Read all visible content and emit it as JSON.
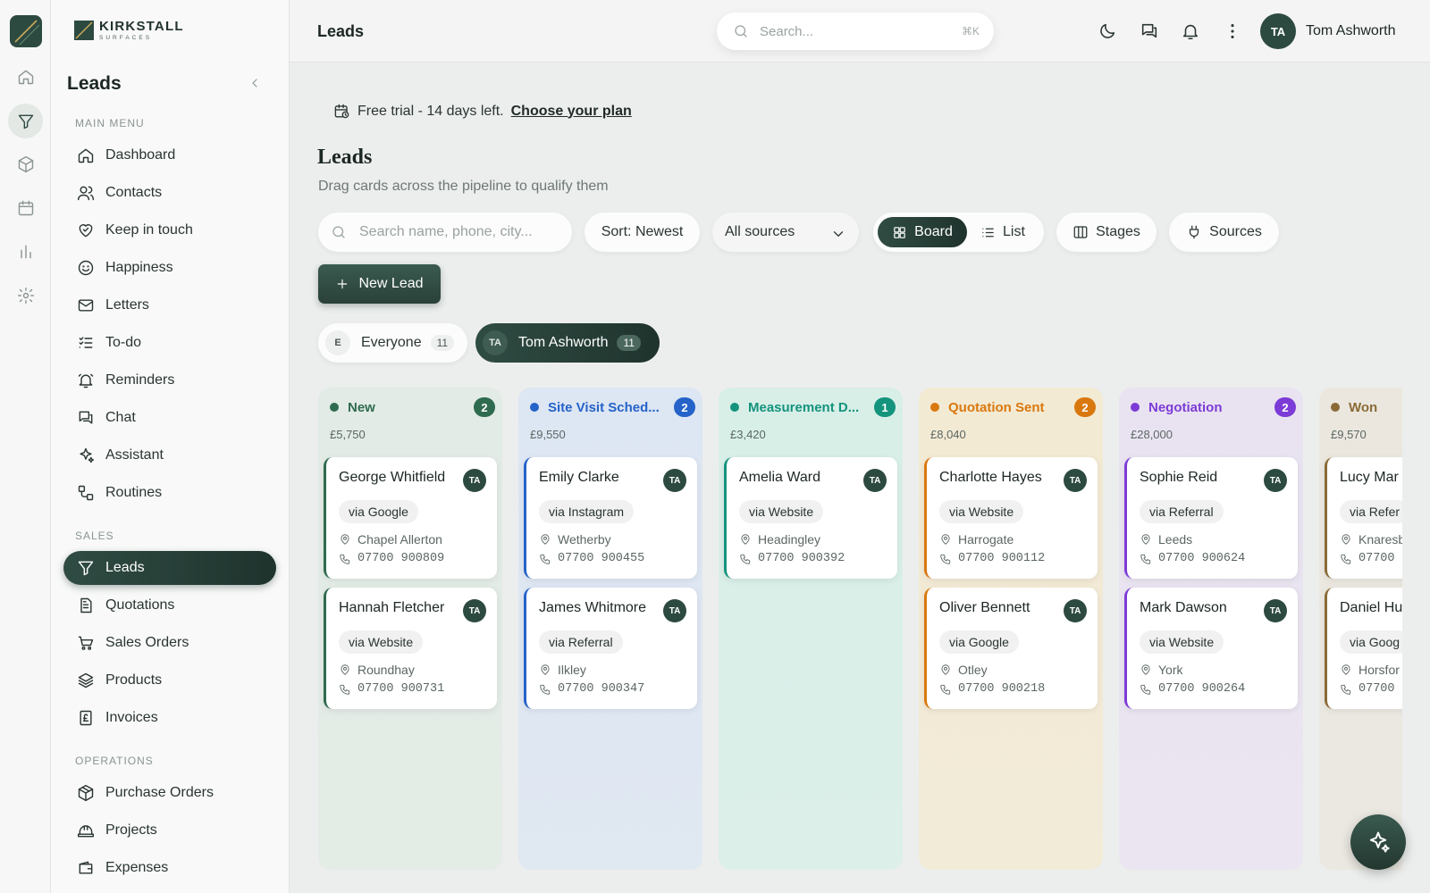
{
  "brand": {
    "name": "KIRKSTALL",
    "tagline": "SURFACES"
  },
  "sidebar": {
    "title": "Leads",
    "sections": [
      {
        "label": "MAIN MENU",
        "items": [
          {
            "label": "Dashboard",
            "icon": "home-icon"
          },
          {
            "label": "Contacts",
            "icon": "users-icon"
          },
          {
            "label": "Keep in touch",
            "icon": "heart-handshake-icon"
          },
          {
            "label": "Happiness",
            "icon": "smile-icon"
          },
          {
            "label": "Letters",
            "icon": "mail-icon"
          },
          {
            "label": "To-do",
            "icon": "checklist-icon"
          },
          {
            "label": "Reminders",
            "icon": "bell-ring-icon"
          },
          {
            "label": "Chat",
            "icon": "chat-icon"
          },
          {
            "label": "Assistant",
            "icon": "sparkles-icon"
          },
          {
            "label": "Routines",
            "icon": "routines-icon"
          }
        ]
      },
      {
        "label": "SALES",
        "items": [
          {
            "label": "Leads",
            "icon": "filter-icon",
            "active": true
          },
          {
            "label": "Quotations",
            "icon": "document-icon"
          },
          {
            "label": "Sales Orders",
            "icon": "cart-icon"
          },
          {
            "label": "Products",
            "icon": "layers-icon"
          },
          {
            "label": "Invoices",
            "icon": "pound-receipt-icon"
          }
        ]
      },
      {
        "label": "OPERATIONS",
        "items": [
          {
            "label": "Purchase Orders",
            "icon": "package-icon"
          },
          {
            "label": "Projects",
            "icon": "hard-hat-icon"
          },
          {
            "label": "Expenses",
            "icon": "wallet-icon"
          }
        ]
      }
    ]
  },
  "topbar": {
    "title": "Leads",
    "search_placeholder": "Search...",
    "search_shortcut": "⌘K",
    "user_initials": "TA",
    "user_name": "Tom Ashworth"
  },
  "trial": {
    "text": "Free trial - 14 days left.",
    "link": "Choose your plan"
  },
  "page": {
    "title": "Leads",
    "subtitle": "Drag cards across the pipeline to qualify them"
  },
  "toolbar": {
    "search_placeholder": "Search name, phone, city...",
    "sort_label": "Sort: Newest",
    "source_filter": "All sources",
    "view_board": "Board",
    "view_list": "List",
    "stages_label": "Stages",
    "sources_label": "Sources",
    "new_lead_label": "New Lead"
  },
  "owner_filter": {
    "everyone": {
      "initial": "E",
      "label": "Everyone",
      "count": "11"
    },
    "user": {
      "initials": "TA",
      "label": "Tom Ashworth",
      "count": "11"
    }
  },
  "columns": [
    {
      "name": "New",
      "count": "2",
      "total": "£5,750",
      "color": "#2f6b4f",
      "bg": "#e2ebe5",
      "cards": [
        {
          "name": "George Whitfield",
          "initials": "TA",
          "source": "via Google",
          "city": "Chapel Allerton",
          "phone": "07700 900809"
        },
        {
          "name": "Hannah Fletcher",
          "initials": "TA",
          "source": "via Website",
          "city": "Roundhay",
          "phone": "07700 900731"
        }
      ]
    },
    {
      "name": "Site Visit Sched...",
      "count": "2",
      "total": "£9,550",
      "color": "#2563c9",
      "bg": "#dde6f3",
      "cards": [
        {
          "name": "Emily Clarke",
          "initials": "TA",
          "source": "via Instagram",
          "city": "Wetherby",
          "phone": "07700 900455"
        },
        {
          "name": "James Whitmore",
          "initials": "TA",
          "source": "via Referral",
          "city": "Ilkley",
          "phone": "07700 900347"
        }
      ]
    },
    {
      "name": "Measurement D...",
      "count": "1",
      "total": "£3,420",
      "color": "#14937d",
      "bg": "#d8efe8",
      "cards": [
        {
          "name": "Amelia Ward",
          "initials": "TA",
          "source": "via Website",
          "city": "Headingley",
          "phone": "07700 900392"
        }
      ]
    },
    {
      "name": "Quotation Sent",
      "count": "2",
      "total": "£8,040",
      "color": "#d9780f",
      "bg": "#f3ead3",
      "cards": [
        {
          "name": "Charlotte Hayes",
          "initials": "TA",
          "source": "via Website",
          "city": "Harrogate",
          "phone": "07700 900112"
        },
        {
          "name": "Oliver Bennett",
          "initials": "TA",
          "source": "via Google",
          "city": "Otley",
          "phone": "07700 900218"
        }
      ]
    },
    {
      "name": "Negotiation",
      "count": "2",
      "total": "£28,000",
      "color": "#7c3bd6",
      "bg": "#e9e3f1",
      "cards": [
        {
          "name": "Sophie Reid",
          "initials": "TA",
          "source": "via Referral",
          "city": "Leeds",
          "phone": "07700 900624"
        },
        {
          "name": "Mark Dawson",
          "initials": "TA",
          "source": "via Website",
          "city": "York",
          "phone": "07700 900264"
        }
      ]
    },
    {
      "name": "Won",
      "count": "",
      "total": "£9,570",
      "color": "#8a6a35",
      "bg": "#ebe7df",
      "cards": [
        {
          "name": "Lucy Mar",
          "initials": "",
          "source": "via Refer",
          "city": "Knaresb",
          "phone": "07700"
        },
        {
          "name": "Daniel Hu",
          "initials": "",
          "source": "via Goog",
          "city": "Horsfor",
          "phone": "07700"
        }
      ]
    }
  ]
}
